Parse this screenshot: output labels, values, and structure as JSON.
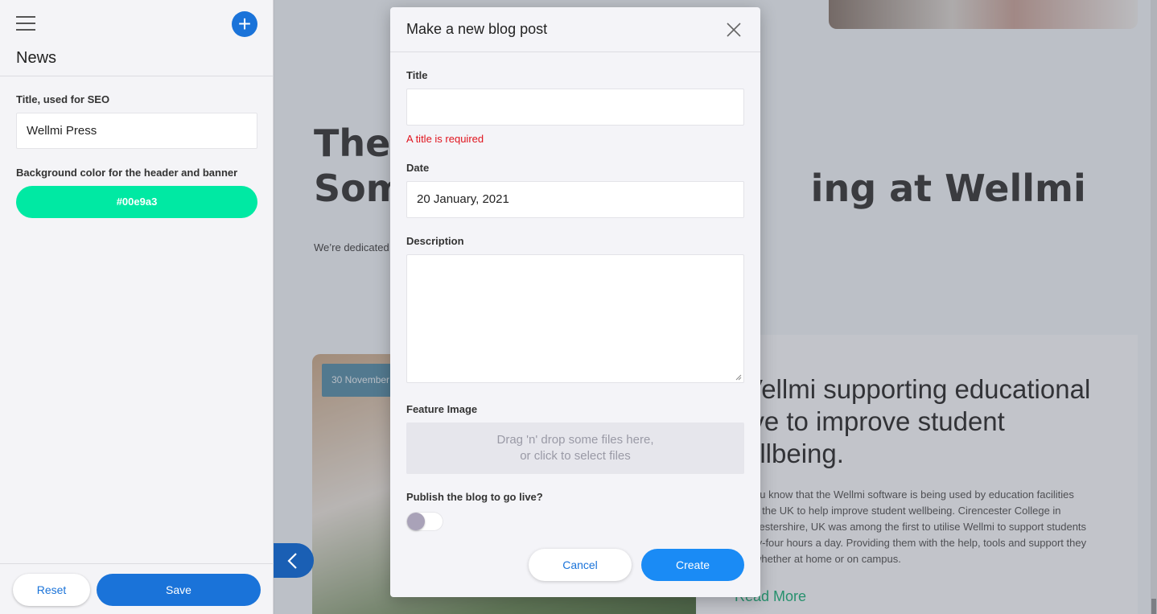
{
  "sidebar": {
    "title": "News",
    "seo_label": "Title, used for SEO",
    "seo_value": "Wellmi Press",
    "bg_color_label": "Background color for the header and banner",
    "bg_color_value": "#00e9a3",
    "reset_label": "Reset",
    "save_label": "Save"
  },
  "page": {
    "headline_line1": "Ther",
    "headline_line2_start": "Som",
    "headline_line2_end": "ing at Wellmi",
    "intro": "We’re dedicated",
    "card": {
      "date": "30 November",
      "title": "Vellmi supporting educational\nive to improve student\nellbeing.",
      "text": "ou know that the Wellmi software is being used by education facilities\ns the UK to help improve student wellbeing. Cirencester College in\ncestershire, UK was among the first to utilise Wellmi to support students\nty-four hours a day. Providing them with the help, tools and support they\nwhether at home or on campus.",
      "read_more": "Read More"
    }
  },
  "modal": {
    "title": "Make a new blog post",
    "title_label": "Title",
    "title_value": "",
    "title_error": "A title is required",
    "date_label": "Date",
    "date_value": "20 January, 2021",
    "description_label": "Description",
    "image_label": "Feature Image",
    "dropzone_line1": "Drag 'n' drop some files here,",
    "dropzone_line2": "or click to select files",
    "publish_label": "Publish the blog to go live?",
    "publish_on": false,
    "cancel_label": "Cancel",
    "create_label": "Create"
  },
  "colors": {
    "accent_blue": "#1a73d9",
    "create_blue": "#1a8bf5",
    "bg_swatch": "#00e9a3",
    "error": "#e0141e"
  },
  "icons": [
    "menu-icon",
    "plus-icon",
    "close-icon",
    "chevron-left-icon",
    "resize-grip-icon"
  ]
}
